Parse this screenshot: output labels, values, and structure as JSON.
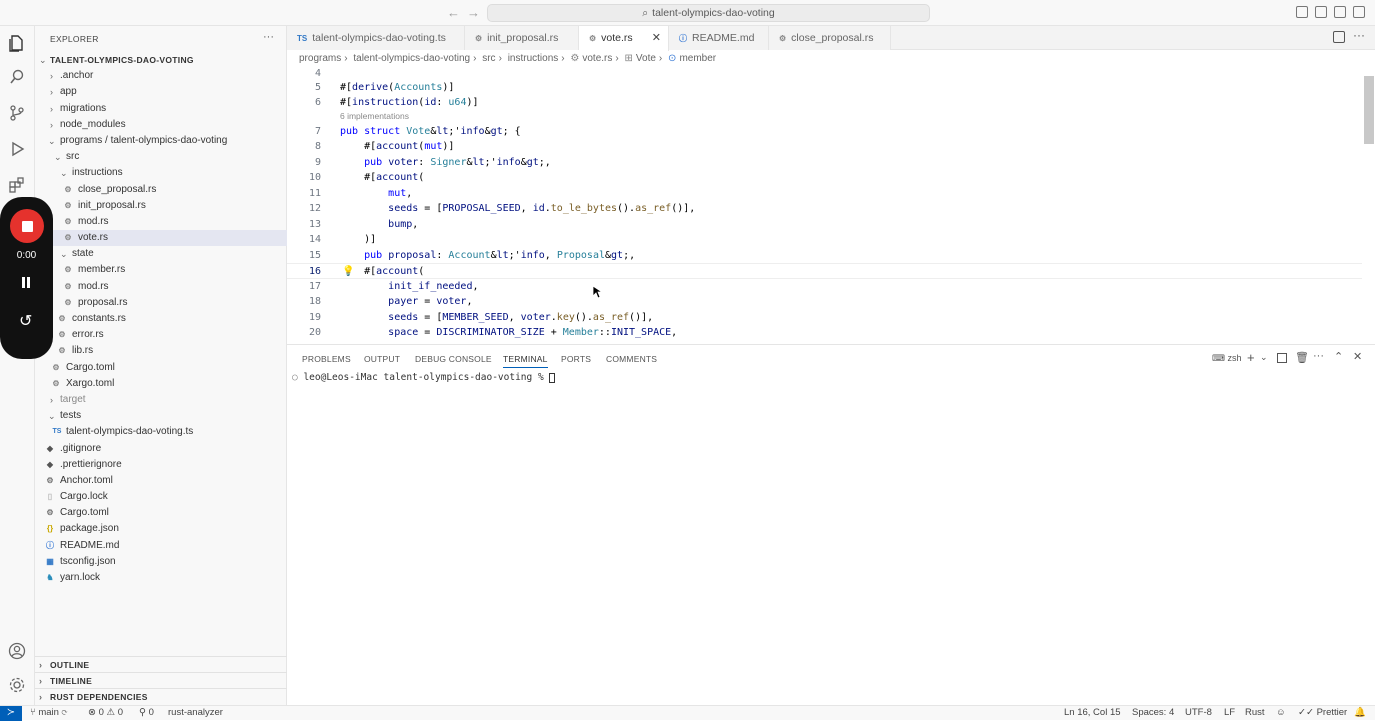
{
  "window": {
    "command_center": "talent-olympics-dao-voting"
  },
  "explorer": {
    "title": "EXPLORER",
    "root": "TALENT-OLYMPICS-DAO-VOTING",
    "items": [
      {
        "label": ".anchor"
      },
      {
        "label": "app"
      },
      {
        "label": "migrations"
      },
      {
        "label": "node_modules"
      },
      {
        "label": "programs / talent-olympics-dao-voting"
      },
      {
        "label": "src"
      },
      {
        "label": "instructions"
      },
      {
        "label": "close_proposal.rs"
      },
      {
        "label": "init_proposal.rs"
      },
      {
        "label": "mod.rs"
      },
      {
        "label": "vote.rs"
      },
      {
        "label": "state"
      },
      {
        "label": "member.rs"
      },
      {
        "label": "mod.rs"
      },
      {
        "label": "proposal.rs"
      },
      {
        "label": "constants.rs"
      },
      {
        "label": "error.rs"
      },
      {
        "label": "lib.rs"
      },
      {
        "label": "Cargo.toml"
      },
      {
        "label": "Xargo.toml"
      },
      {
        "label": "target"
      },
      {
        "label": "tests"
      },
      {
        "label": "talent-olympics-dao-voting.ts"
      },
      {
        "label": ".gitignore"
      },
      {
        "label": ".prettierignore"
      },
      {
        "label": "Anchor.toml"
      },
      {
        "label": "Cargo.lock"
      },
      {
        "label": "Cargo.toml"
      },
      {
        "label": "package.json"
      },
      {
        "label": "README.md"
      },
      {
        "label": "tsconfig.json"
      },
      {
        "label": "yarn.lock"
      }
    ],
    "sections": [
      "OUTLINE",
      "TIMELINE",
      "RUST DEPENDENCIES"
    ]
  },
  "tabs": [
    {
      "label": "talent-olympics-dao-voting.ts",
      "icon": "TS"
    },
    {
      "label": "init_proposal.rs",
      "icon": "rust-gear-icon"
    },
    {
      "label": "vote.rs",
      "icon": "rust-gear-icon"
    },
    {
      "label": "README.md",
      "icon": "info-icon"
    },
    {
      "label": "close_proposal.rs",
      "icon": "rust-gear-icon"
    }
  ],
  "breadcrumb": [
    "programs",
    "talent-olympics-dao-voting",
    "src",
    "instructions",
    "vote.rs",
    "Vote",
    "member"
  ],
  "editor": {
    "codelens": "6 implementations",
    "lines": [
      {
        "n": "4",
        "t": ""
      },
      {
        "n": "5",
        "t": "#[derive(Accounts)]"
      },
      {
        "n": "6",
        "t": "#[instruction(id: u64)]"
      },
      {
        "n": "7",
        "t": "pub struct Vote<'info> {"
      },
      {
        "n": "8",
        "t": "    #[account(mut)]"
      },
      {
        "n": "9",
        "t": "    pub voter: Signer<'info>,"
      },
      {
        "n": "10",
        "t": "    #[account("
      },
      {
        "n": "11",
        "t": "        mut,"
      },
      {
        "n": "12",
        "t": "        seeds = [PROPOSAL_SEED, id.to_le_bytes().as_ref()],"
      },
      {
        "n": "13",
        "t": "        bump,"
      },
      {
        "n": "14",
        "t": "    )]"
      },
      {
        "n": "15",
        "t": "    pub proposal: Account<'info, Proposal>,"
      },
      {
        "n": "16",
        "t": "    #[account("
      },
      {
        "n": "17",
        "t": "        init_if_needed,"
      },
      {
        "n": "18",
        "t": "        payer = voter,"
      },
      {
        "n": "19",
        "t": "        seeds = [MEMBER_SEED, voter.key().as_ref()],"
      },
      {
        "n": "20",
        "t": "        space = DISCRIMINATOR_SIZE + Member::INIT_SPACE,"
      }
    ]
  },
  "panel": {
    "tabs": [
      "PROBLEMS",
      "OUTPUT",
      "DEBUG CONSOLE",
      "TERMINAL",
      "PORTS",
      "COMMENTS"
    ],
    "shell": "zsh",
    "terminal_line": "leo@Leos-iMac talent-olympics-dao-voting % "
  },
  "recorder": {
    "time": "0:00"
  },
  "statusbar": {
    "branch": "main",
    "errors": "0",
    "warnings": "0",
    "info": "0",
    "analyzer": "rust-analyzer",
    "position": "Ln 16, Col 15",
    "spaces": "Spaces: 4",
    "encoding": "UTF-8",
    "eol": "LF",
    "language": "Rust",
    "formatter": "Prettier"
  },
  "colors": {
    "accent": "#005fb8",
    "record": "#e5322d",
    "selected_row": "#e4e6f1"
  }
}
